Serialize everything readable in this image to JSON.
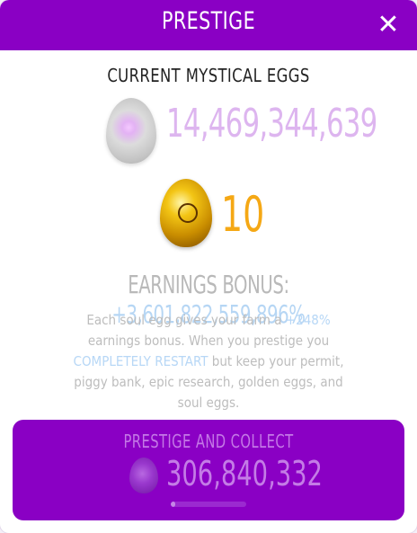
{
  "header": {
    "title": "PRESTIGE",
    "close_label": "✕"
  },
  "subtitle": "CURRENT MYSTICAL EGGS",
  "soul_eggs": {
    "count": "14,469,344,639",
    "icon": "soul-egg-icon"
  },
  "golden_eggs": {
    "count": "10",
    "icon": "golden-egg-icon"
  },
  "earnings": {
    "label": "EARNINGS BONUS:",
    "value": "+3,601,822,559,896%"
  },
  "description": {
    "part1": "Each soul egg gives your farm a ",
    "bonus": "+248%",
    "part2": " earnings bonus. When you prestige you ",
    "restart": "COMPLETELY RESTART",
    "part3": " but keep your permit, piggy bank, epic research, golden eggs, and soul eggs."
  },
  "action": {
    "label": "PRESTIGE AND COLLECT",
    "value": "306,840,332",
    "progress_fraction": 0.06
  },
  "colors": {
    "accent_purple": "#8a00c4",
    "soul_text": "#ddb5ef",
    "golden_text": "#f5a815",
    "highlight_blue": "#b7d7f6"
  }
}
